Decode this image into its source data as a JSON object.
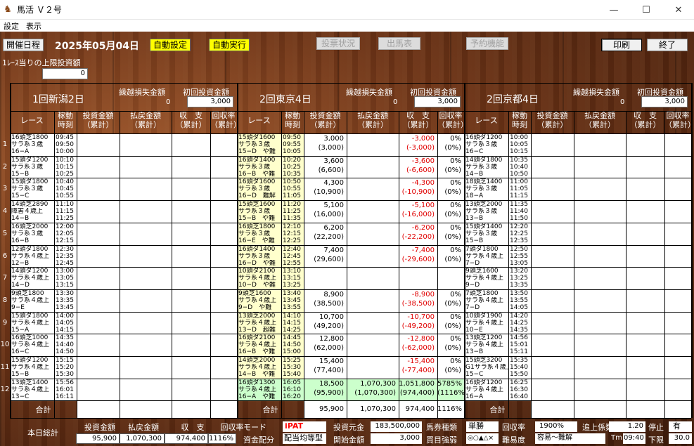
{
  "window": {
    "title": "馬活 Ｖ２号",
    "min": "—",
    "max": "☐",
    "close": "✕"
  },
  "menu": [
    "設定",
    "表示"
  ],
  "toolbar": {
    "schedule": "開催日程",
    "date": "2025年05月04日",
    "auto_set": "自動設定",
    "auto_run": "自動実行",
    "vote_status": "投票状況",
    "race_card": "出馬表",
    "reserve": "予約機能",
    "print": "印刷",
    "exit": "終了"
  },
  "limit": {
    "label": "1ﾚｰｽ当りの上限投資額",
    "value": "0"
  },
  "venues": [
    {
      "name": "1回新潟2日",
      "loss_label": "繰越損失金額",
      "loss": "0",
      "init_label": "初回投資金額",
      "init": "3,000"
    },
    {
      "name": "2回東京4日",
      "loss_label": "繰越損失金額",
      "loss": "0",
      "init_label": "初回投資金額",
      "init": "3,000"
    },
    {
      "name": "2回京都4日",
      "loss_label": "繰越損失金額",
      "loss": "0",
      "init_label": "初回投資金額",
      "init": "3,000"
    }
  ],
  "headers": {
    "race": "レース",
    "t1": "稼動",
    "t2": "時刻",
    "inv1": "投資金額",
    "inv2": "（累計）",
    "pay1": "払戻金額",
    "pay2": "（累計）",
    "bal1": "収　支",
    "bal2": "（累計）",
    "rec1": "回収率",
    "rec2": "（累計）"
  },
  "rows": [
    {
      "n": "1",
      "a": {
        "r": [
          "16頭芝1800",
          "サラ系３歳",
          "16−A"
        ],
        "t": [
          "09:45",
          "09:50",
          "10:00"
        ]
      },
      "b": {
        "r": [
          "15頭ダ1600",
          "サラ系３歳",
          "15−D　や難"
        ],
        "t": [
          "09:50",
          "09:55",
          "10:05"
        ],
        "inv": [
          "3,000",
          "(3,000)"
        ],
        "bal": [
          "-3,000",
          "(-3,000)"
        ],
        "rec": [
          "0%",
          "(0%)"
        ]
      },
      "c": {
        "r": [
          "16頭ダ1200",
          "サラ系３歳",
          "16−C"
        ],
        "t": [
          "10:00",
          "10:05",
          "10:15"
        ]
      }
    },
    {
      "n": "2",
      "a": {
        "r": [
          "15頭ダ1200",
          "サラ系３歳",
          "15−B"
        ],
        "t": [
          "10:10",
          "10:15",
          "10:25"
        ]
      },
      "b": {
        "r": [
          "16頭ダ1400",
          "サラ系３歳",
          "16−B　や難"
        ],
        "t": [
          "10:20",
          "10:25",
          "10:35"
        ],
        "inv": [
          "3,600",
          "(6,600)"
        ],
        "bal": [
          "-3,600",
          "(-6,600)"
        ],
        "rec": [
          "0%",
          "(0%)"
        ]
      },
      "c": {
        "r": [
          "14頭ダ1800",
          "サラ系３歳",
          "14−B"
        ],
        "t": [
          "10:35",
          "10:40",
          "10:50"
        ]
      }
    },
    {
      "n": "3",
      "a": {
        "r": [
          "15頭ダ1800",
          "サラ系３歳",
          "15−C"
        ],
        "t": [
          "10:40",
          "10:45",
          "10:55"
        ]
      },
      "b": {
        "r": [
          "16頭ダ1600",
          "サラ系３歳",
          "16−D　難解"
        ],
        "t": [
          "10:50",
          "10:55",
          "11:05"
        ],
        "inv": [
          "4,300",
          "(10,900)"
        ],
        "bal": [
          "-4,300",
          "(-10,900)"
        ],
        "rec": [
          "0%",
          "(0%)"
        ]
      },
      "c": {
        "r": [
          "18頭芝1400",
          "サラ系３歳",
          "18−A"
        ],
        "t": [
          "11:00",
          "11:05",
          "11:15"
        ]
      }
    },
    {
      "n": "4",
      "a": {
        "r": [
          "14頭芝2890",
          "障害４歳上",
          "14−B"
        ],
        "t": [
          "11:10",
          "11:15",
          "11:25"
        ]
      },
      "b": {
        "r": [
          "15頭芝1600",
          "サラ系３歳",
          "15−B　や難"
        ],
        "t": [
          "11:20",
          "11:25",
          "11:35"
        ],
        "inv": [
          "5,100",
          "(16,000)"
        ],
        "bal": [
          "-5,100",
          "(-16,000)"
        ],
        "rec": [
          "0%",
          "(0%)"
        ]
      },
      "c": {
        "r": [
          "13頭芝2000",
          "サラ系３歳",
          "13−B"
        ],
        "t": [
          "11:35",
          "11:40",
          "11:50"
        ]
      }
    },
    {
      "n": "5",
      "a": {
        "r": [
          "16頭芝2000",
          "サラ系３歳",
          "16−B"
        ],
        "t": [
          "12:00",
          "12:05",
          "12:15"
        ]
      },
      "b": {
        "r": [
          "16頭芝1800",
          "サラ系３歳",
          "16−E　や難"
        ],
        "t": [
          "12:10",
          "12:15",
          "12:25"
        ],
        "inv": [
          "6,200",
          "(22,200)"
        ],
        "bal": [
          "-6,200",
          "(-22,200)"
        ],
        "rec": [
          "0%",
          "(0%)"
        ]
      },
      "c": {
        "r": [
          "15頭ダ1400",
          "サラ系３歳",
          "15−B"
        ],
        "t": [
          "12:20",
          "12:25",
          "12:35"
        ]
      }
    },
    {
      "n": "6",
      "a": {
        "r": [
          "12頭ダ1800",
          "サラ系４歳上",
          "12−B"
        ],
        "t": [
          "12:30",
          "12:35",
          "12:45"
        ]
      },
      "b": {
        "r": [
          "16頭ダ1400",
          "サラ系３歳",
          "16−D　や難"
        ],
        "t": [
          "12:40",
          "12:45",
          "12:55"
        ],
        "inv": [
          "7,400",
          "(29,600)"
        ],
        "bal": [
          "-7,400",
          "(-29,600)"
        ],
        "rec": [
          "0%",
          "(0%)"
        ]
      },
      "c": {
        "r": [
          "7頭ダ1800",
          "サラ系４歳上",
          "7−D"
        ],
        "t": [
          "12:50",
          "12:55",
          "13:05"
        ]
      }
    },
    {
      "n": "7",
      "a": {
        "r": [
          "14頭ダ1200",
          "サラ系４歳上",
          "14−D"
        ],
        "t": [
          "13:00",
          "13:05",
          "13:15"
        ]
      },
      "b": {
        "r": [
          "10頭ダ2100",
          "サラ系４歳上",
          "10−D　や難"
        ],
        "t": [
          "13:10",
          "13:15",
          "13:25"
        ],
        "inv": [
          "",
          ""
        ],
        "bal": [
          "",
          ""
        ],
        "rec": [
          "",
          ""
        ]
      },
      "c": {
        "r": [
          "9頭芝1600",
          "サラ系４歳上",
          "9−D"
        ],
        "t": [
          "13:20",
          "13:25",
          "13:35"
        ]
      }
    },
    {
      "n": "8",
      "a": {
        "r": [
          "9頭芝1800",
          "サラ系４歳上",
          "9−E"
        ],
        "t": [
          "13:30",
          "13:35",
          "13:45"
        ]
      },
      "b": {
        "r": [
          "9頭芝1600",
          "サラ系４歳上",
          "9−D　や難"
        ],
        "t": [
          "13:40",
          "13:45",
          "13:55"
        ],
        "inv": [
          "8,900",
          "(38,500)"
        ],
        "bal": [
          "-8,900",
          "(-38,500)"
        ],
        "rec": [
          "0%",
          "(0%)"
        ]
      },
      "c": {
        "r": [
          "7頭芝1800",
          "サラ系４歳上",
          "7−D"
        ],
        "t": [
          "13:50",
          "13:55",
          "14:05"
        ]
      }
    },
    {
      "n": "9",
      "a": {
        "r": [
          "15頭ダ1800",
          "サラ系４歳上",
          "15−A"
        ],
        "t": [
          "14:00",
          "14:05",
          "14:15"
        ]
      },
      "b": {
        "r": [
          "13頭芝2000",
          "サラ系４歳上",
          "13−D　超難"
        ],
        "t": [
          "14:10",
          "14:15",
          "14:25"
        ],
        "inv": [
          "10,700",
          "(49,200)"
        ],
        "bal": [
          "-10,700",
          "(-49,200)"
        ],
        "rec": [
          "0%",
          "(0%)"
        ]
      },
      "c": {
        "r": [
          "10頭ダ1900",
          "サラ系４歳上",
          "10−E"
        ],
        "t": [
          "14:20",
          "14:25",
          "14:35"
        ]
      }
    },
    {
      "n": "10",
      "a": {
        "r": [
          "16頭芝1000",
          "サラ系４歳上",
          "16−C"
        ],
        "t": [
          "14:35",
          "14:40",
          "14:50"
        ]
      },
      "b": {
        "r": [
          "16頭ダ2100",
          "サラ系４歳上",
          "16−B　や難"
        ],
        "t": [
          "14:45",
          "14:50",
          "15:00"
        ],
        "inv": [
          "12,800",
          "(62,000)"
        ],
        "bal": [
          "-12,800",
          "(-62,000)"
        ],
        "rec": [
          "0%",
          "(0%)"
        ]
      },
      "c": {
        "r": [
          "13頭芝1200",
          "サラ系４歳上",
          "13−B"
        ],
        "t": [
          "14:56",
          "15:01",
          "15:11"
        ]
      }
    },
    {
      "n": "11",
      "a": {
        "r": [
          "15頭ダ1200",
          "サラ系４歳上",
          "15−B"
        ],
        "t": [
          "15:15",
          "15:20",
          "15:30"
        ]
      },
      "b": {
        "r": [
          "14頭芝2000",
          "サラ系４歳上",
          "14−B　や難"
        ],
        "t": [
          "15:25",
          "15:30",
          "15:40"
        ],
        "inv": [
          "15,400",
          "(77,400)"
        ],
        "bal": [
          "-15,400",
          "(-77,400)"
        ],
        "rec": [
          "0%",
          "(0%)"
        ]
      },
      "c": {
        "r": [
          "15頭芝3200",
          "G1サラ系４歳上",
          "15−C"
        ],
        "t": [
          "15:35",
          "15:40",
          "15:50"
        ]
      }
    },
    {
      "n": "12",
      "a": {
        "r": [
          "13頭芝1400",
          "サラ系４歳上",
          "13−C"
        ],
        "t": [
          "15:56",
          "16:01",
          "16:11"
        ]
      },
      "b": {
        "r": [
          "16頭ダ1300",
          "サラ系４歳上",
          "16−A　や難"
        ],
        "t": [
          "16:05",
          "16:10",
          "16:20"
        ],
        "inv": [
          "18,500",
          "(95,900)"
        ],
        "pay": [
          "1,070,300",
          "(1,070,300)"
        ],
        "bal": [
          "1,051,800",
          "(974,400)"
        ],
        "rec": [
          "5785%",
          "(1116%)"
        ]
      },
      "c": {
        "r": [
          "16頭ダ1200",
          "サラ系４歳上",
          "16−A"
        ],
        "t": [
          "16:25",
          "16:30",
          "16:40"
        ]
      }
    }
  ],
  "totals": {
    "label": "合計",
    "b_inv": "95,900",
    "b_pay": "1,070,300",
    "b_bal": "974,400",
    "b_rec": "1116%"
  },
  "summary": {
    "label": "本日総計",
    "inv_lbl": "投資金額",
    "pay_lbl": "払戻金額",
    "bal_lbl": "収　支",
    "rec_lbl": "回収率",
    "inv": "95,900",
    "pay": "1,070,300",
    "bal": "974,400",
    "rec": "1116%",
    "mode_lbl": "モード",
    "mode": "iPAT",
    "alloc_lbl": "資金配分",
    "alloc": "配当均等型",
    "fund_lbl": "投資元金",
    "fund": "183,500,000",
    "start_lbl": "開始金額",
    "start": "3,000",
    "bet_lbl": "馬券種類",
    "bet": "単勝",
    "buy_lbl": "買目強弱",
    "buy": "◎○▲△×",
    "rr_lbl": "回収率",
    "rr": "1900%",
    "diff_lbl": "難易度",
    "diff": "容易～難解",
    "coef_lbl": "追上係数",
    "coef": "1.20",
    "tm_lbl": "Tm",
    "tm": "09:40",
    "stop_lbl": "停止",
    "stop": "有",
    "low_lbl": "下限",
    "low": "30.0"
  }
}
